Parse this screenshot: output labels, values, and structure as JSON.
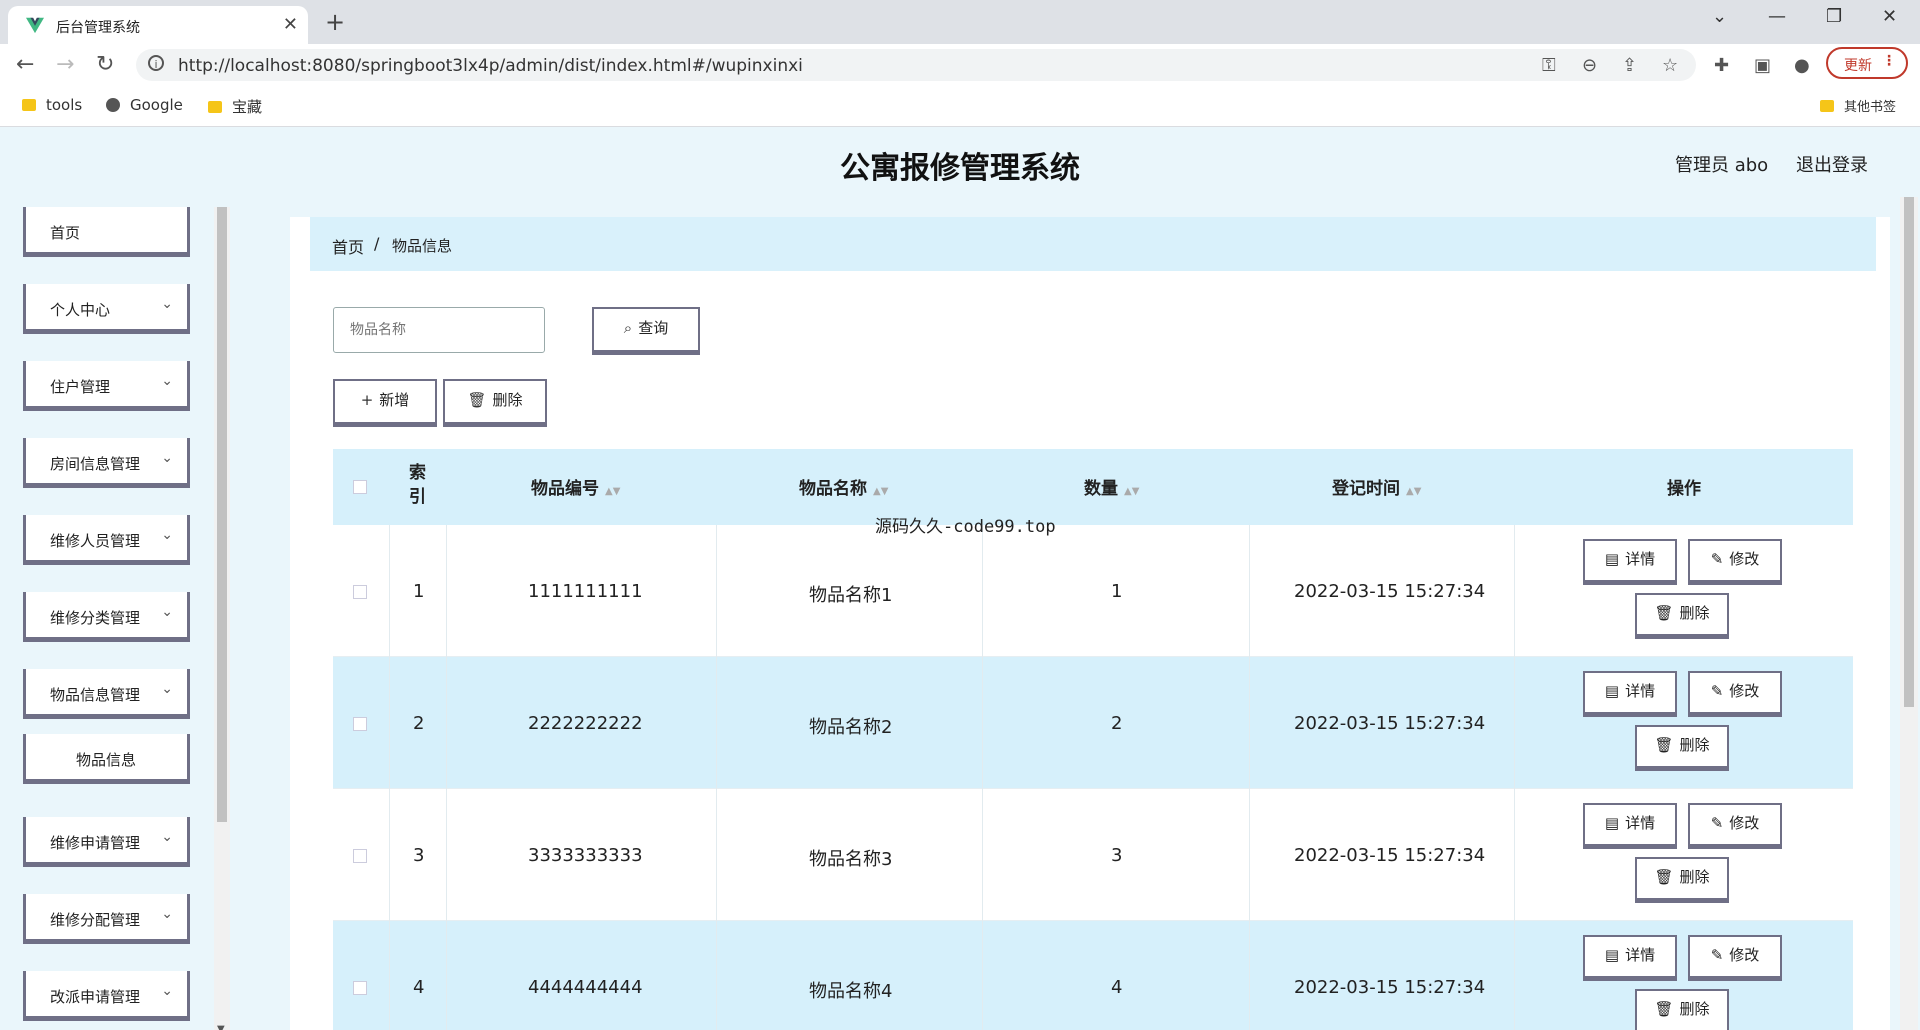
{
  "browser": {
    "tab_title": "后台管理系统",
    "url": "http://localhost:8080/springboot3lx4p/admin/dist/index.html#/wupinxinxi",
    "update_label": "更新",
    "bookmarks": [
      "tools",
      "Google",
      "宝藏"
    ],
    "other_bookmarks": "其他书签"
  },
  "header": {
    "title": "公寓报修管理系统",
    "user": "管理员 abo",
    "logout": "退出登录"
  },
  "sidebar": {
    "items": [
      {
        "label": "首页",
        "expandable": false
      },
      {
        "label": "个人中心",
        "expandable": true
      },
      {
        "label": "住户管理",
        "expandable": true
      },
      {
        "label": "房间信息管理",
        "expandable": true
      },
      {
        "label": "维修人员管理",
        "expandable": true
      },
      {
        "label": "维修分类管理",
        "expandable": true
      },
      {
        "label": "物品信息管理",
        "expandable": true
      },
      {
        "label": "物品信息",
        "expandable": false,
        "sub": true
      },
      {
        "label": "维修申请管理",
        "expandable": true
      },
      {
        "label": "维修分配管理",
        "expandable": true
      },
      {
        "label": "改派申请管理",
        "expandable": true
      }
    ]
  },
  "breadcrumb": {
    "home": "首页",
    "separator": "/",
    "current": "物品信息"
  },
  "search": {
    "placeholder": "物品名称",
    "button": "查询"
  },
  "actions": {
    "add": "新增",
    "delete": "删除"
  },
  "table": {
    "headers": {
      "index": "索引",
      "code": "物品编号",
      "name": "物品名称",
      "qty": "数量",
      "time": "登记时间",
      "ops": "操作"
    },
    "rows": [
      {
        "index": "1",
        "code": "1111111111",
        "name": "物品名称1",
        "qty": "1",
        "time": "2022-03-15 15:27:34"
      },
      {
        "index": "2",
        "code": "2222222222",
        "name": "物品名称2",
        "qty": "2",
        "time": "2022-03-15 15:27:34"
      },
      {
        "index": "3",
        "code": "3333333333",
        "name": "物品名称3",
        "qty": "3",
        "time": "2022-03-15 15:27:34"
      },
      {
        "index": "4",
        "code": "4444444444",
        "name": "物品名称4",
        "qty": "4",
        "time": "2022-03-15 15:27:34"
      }
    ],
    "row_actions": {
      "detail": "详情",
      "edit": "修改",
      "delete": "删除"
    }
  },
  "overlay_text": "源码久久-code99.top",
  "colors": {
    "accent_light": "#d6f0fb",
    "button_border": "#6f6f86",
    "page_bg": "#eaf6fb"
  }
}
